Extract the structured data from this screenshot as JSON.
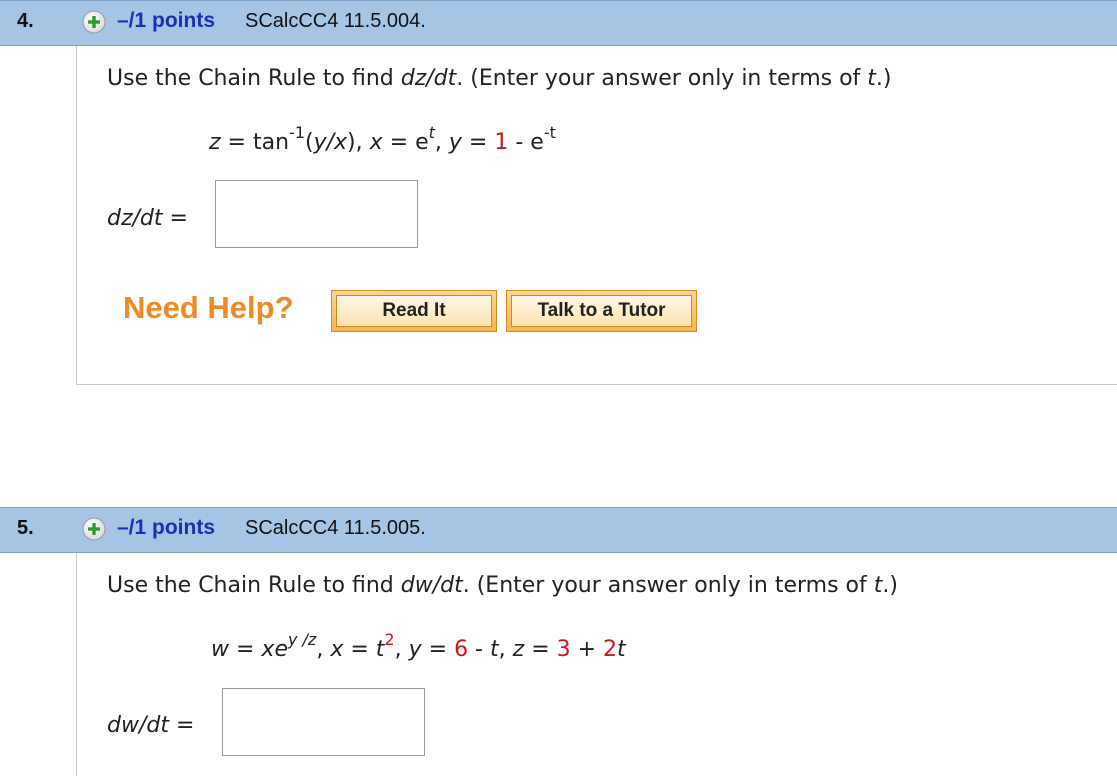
{
  "questions": [
    {
      "number": "4.",
      "points": "–/1 points",
      "source": "SCalcCC4 11.5.004.",
      "prompt": {
        "before": "Use the Chain Rule to find ",
        "target": "dz/dt",
        "middle": ". (Enter your answer only in terms of ",
        "var": "t",
        "after": ".)"
      },
      "equation": {
        "z_lhs": "z",
        "z_eq": " = tan",
        "z_sup": "-1",
        "z_arg_open": "(",
        "z_arg": "y/x",
        "z_arg_close": "),",
        "x_lhs": "x",
        "x_eq": " = e",
        "x_sup": "t",
        "x_comma": ",",
        "y_lhs": "y",
        "y_eq": " = ",
        "y_const": "1",
        "y_rest": " - e",
        "y_sup": "-t"
      },
      "answer_label": "dz/dt",
      "answer_equals": " =",
      "answer_value": "",
      "need_help": "Need Help?",
      "read_it": "Read It",
      "talk_tutor": "Talk to a Tutor"
    },
    {
      "number": "5.",
      "points": "–/1 points",
      "source": "SCalcCC4 11.5.005.",
      "prompt": {
        "before": "Use the Chain Rule to find ",
        "target": "dw/dt",
        "middle": ". (Enter your answer only in terms of ",
        "var": "t",
        "after": ".)"
      },
      "equation": {
        "w_lhs": "w",
        "w_eq": " = ",
        "w_base": "xe",
        "w_sup": "y /z",
        "w_comma": ",",
        "x_lhs": "x",
        "x_eq": " = ",
        "x_base": "t",
        "x_sup": "2",
        "x_comma": ",",
        "y_lhs": "y",
        "y_eq": " = ",
        "y_const": "6",
        "y_rest": " - ",
        "y_var": "t",
        "y_comma": ",",
        "z_lhs": "z",
        "z_eq": " = ",
        "z_const1": "3",
        "z_plus": " + ",
        "z_const2": "2",
        "z_var": "t"
      },
      "answer_label": "dw/dt",
      "answer_equals": " =",
      "answer_value": ""
    }
  ],
  "colors": {
    "header_bg": "#a4c5e3",
    "points_text": "#1a2fb8",
    "constant_red": "#d0141c",
    "need_help_orange": "#f08a24",
    "plus_icon_green": "#2e9b2e"
  }
}
